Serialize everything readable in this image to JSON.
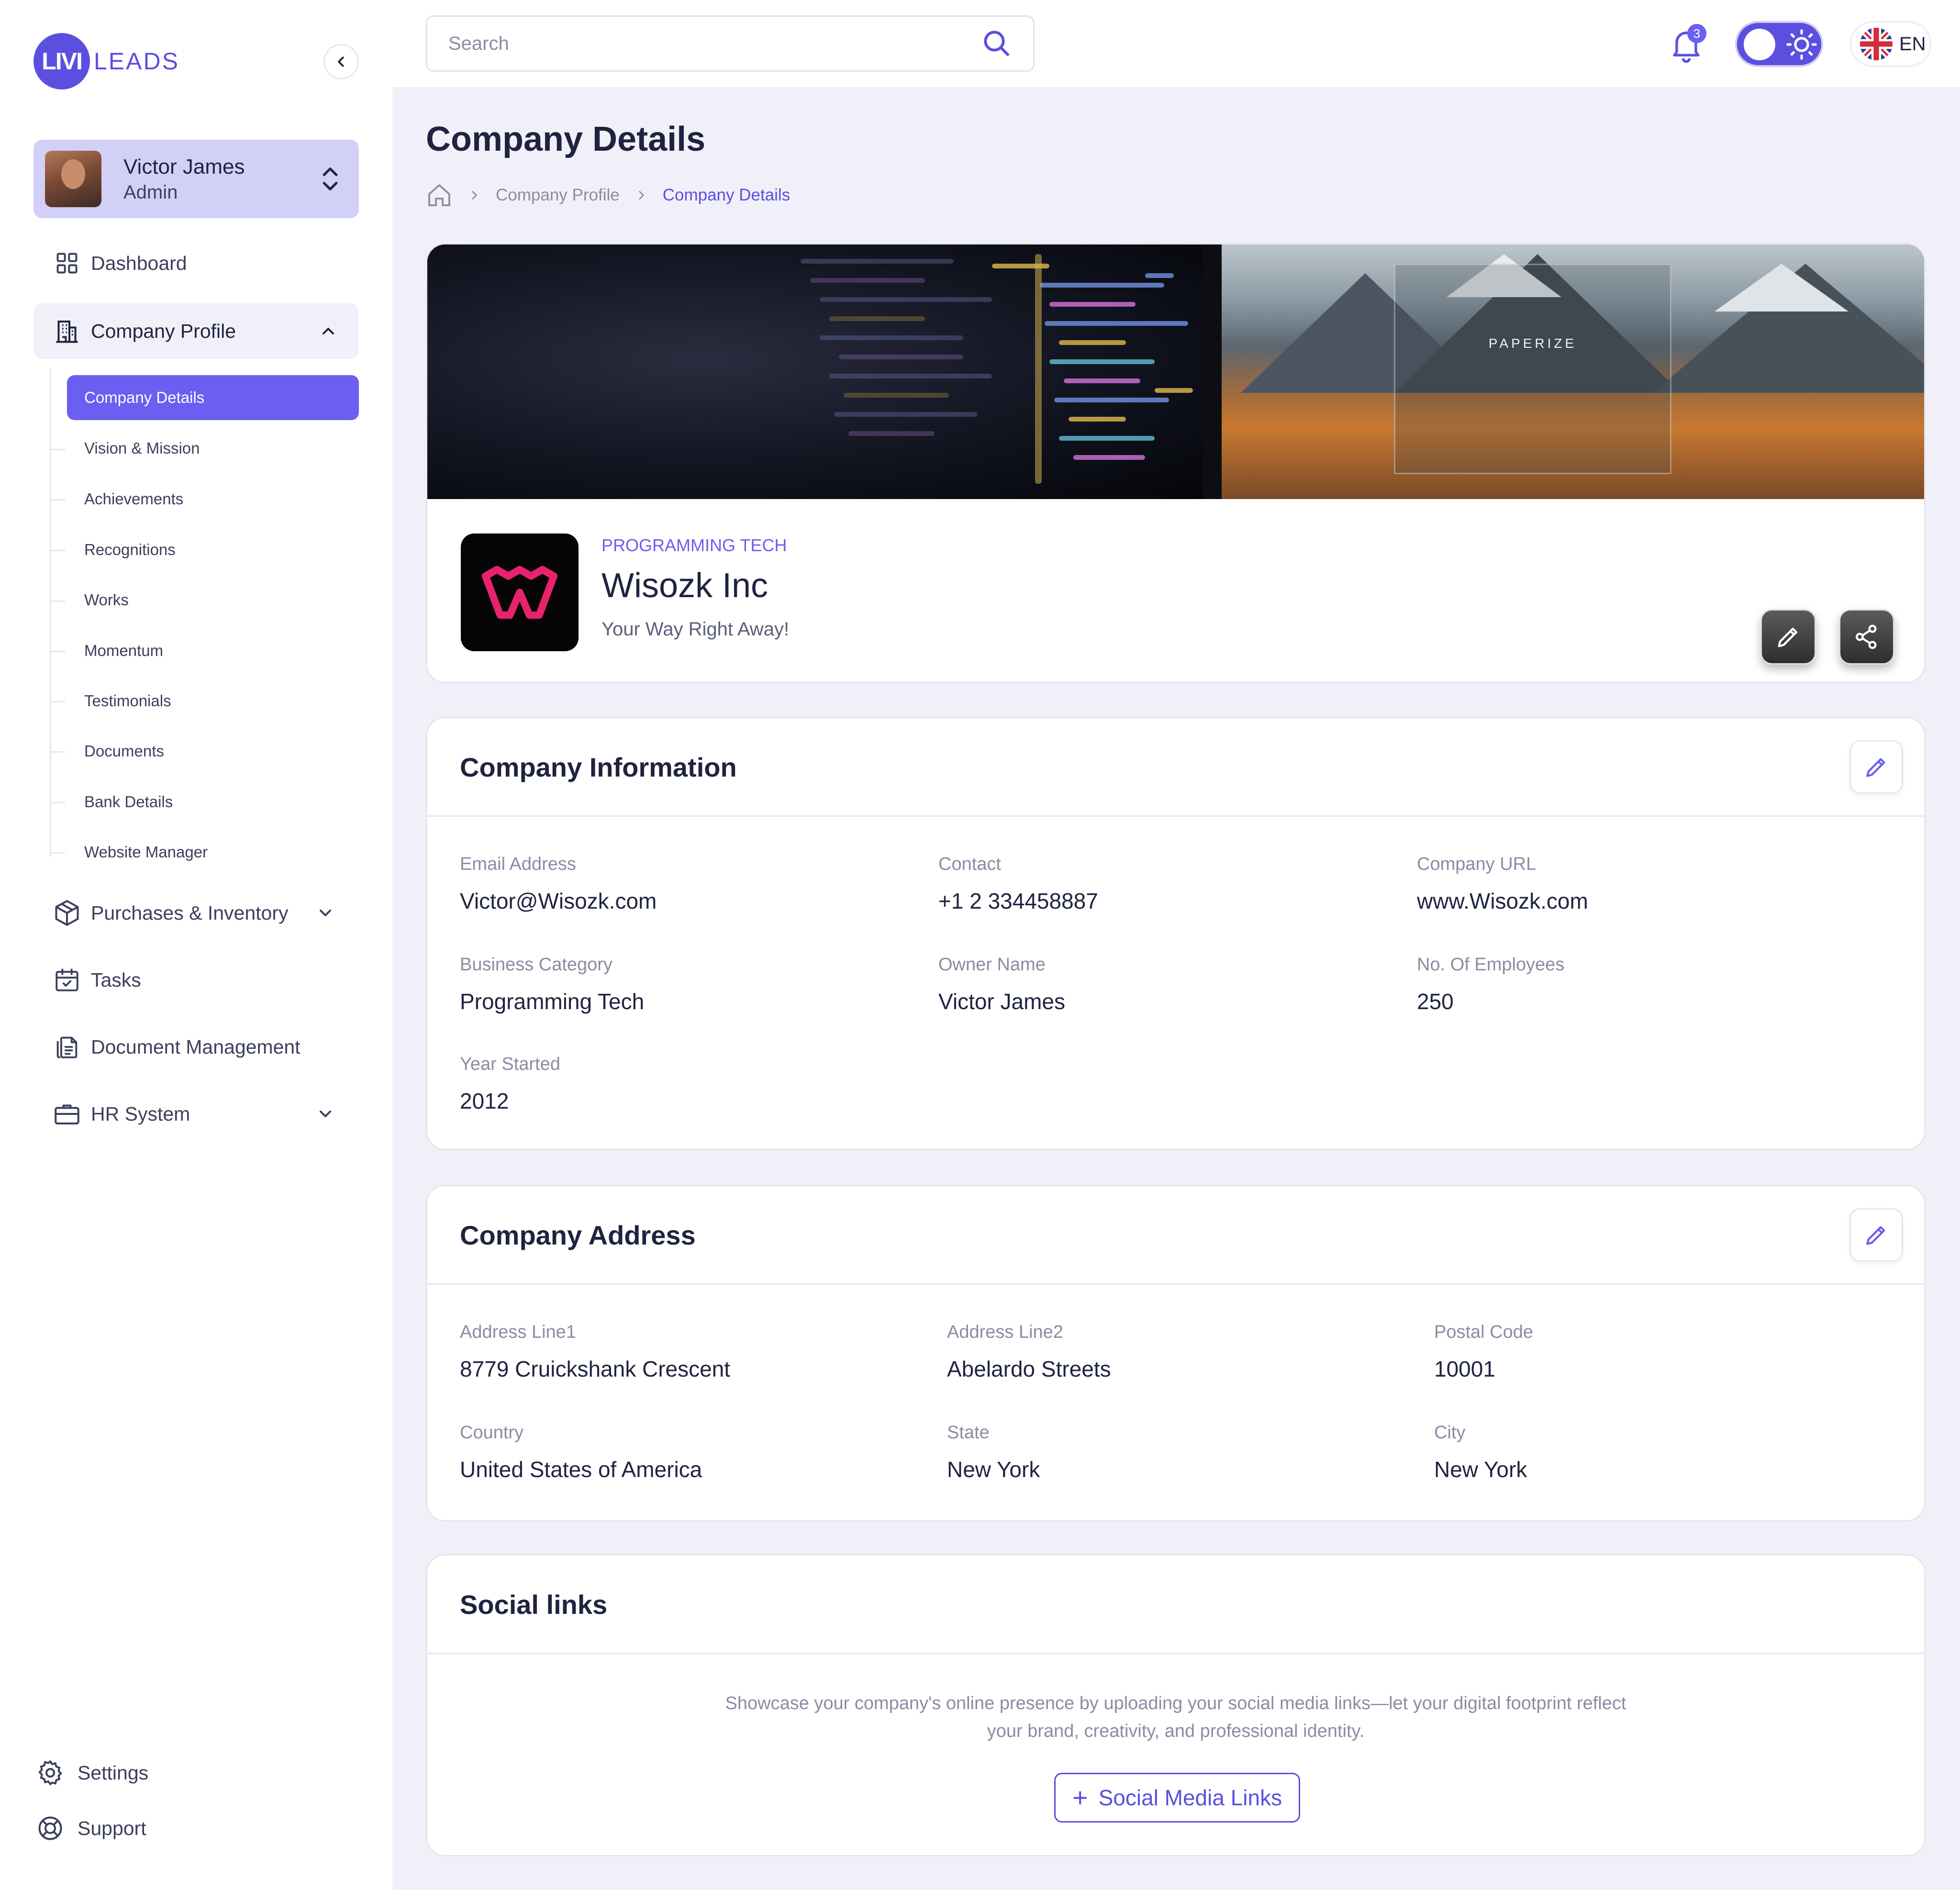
{
  "brand": {
    "logo_mark": "LIVI",
    "logo_text": "LEADS",
    "color": "#5b4fe0"
  },
  "user": {
    "name": "Victor James",
    "role": "Admin"
  },
  "nav": {
    "dashboard": "Dashboard",
    "company_profile": "Company Profile",
    "sub_items": [
      "Company Details",
      "Vision & Mission",
      "Achievements",
      "Recognitions",
      "Works",
      "Momentum",
      "Testimonials",
      "Documents",
      "Bank Details",
      "Website Manager"
    ],
    "purchases": "Purchases & Inventory",
    "tasks": "Tasks",
    "documents": "Document Management",
    "hr": "HR System",
    "settings": "Settings",
    "support": "Support"
  },
  "topbar": {
    "search_placeholder": "Search",
    "notification_count": "3",
    "language": "EN"
  },
  "page": {
    "title": "Company Details",
    "breadcrumb": [
      "Company Profile",
      "Company Details"
    ]
  },
  "hero": {
    "brand_text": "PAPERIZE"
  },
  "company": {
    "category": "PROGRAMMING TECH",
    "name": "Wisozk Inc",
    "tagline": "Your Way Right Away!"
  },
  "info": {
    "title": "Company Information",
    "fields": [
      {
        "label": "Email Address",
        "value": "Victor@Wisozk.com"
      },
      {
        "label": "Contact",
        "value": "+1 2 334458887"
      },
      {
        "label": "Company URL",
        "value": "www.Wisozk.com"
      },
      {
        "label": "Business Category",
        "value": "Programming Tech"
      },
      {
        "label": "Owner Name",
        "value": "Victor James"
      },
      {
        "label": "No. Of Employees",
        "value": "250"
      },
      {
        "label": "Year Started",
        "value": "2012"
      }
    ]
  },
  "address": {
    "title": "Company Address",
    "fields": [
      {
        "label": "Address Line1",
        "value": "8779 Cruickshank Crescent"
      },
      {
        "label": "Address Line2",
        "value": "Abelardo Streets"
      },
      {
        "label": "Postal Code",
        "value": "10001"
      },
      {
        "label": "Country",
        "value": "United States of America"
      },
      {
        "label": "State",
        "value": "New York"
      },
      {
        "label": "City",
        "value": "New York"
      }
    ]
  },
  "social": {
    "title": "Social links",
    "description_line1": "Showcase your company's online presence by uploading your social media links—let your digital footprint reflect",
    "description_line2": "your brand, creativity, and professional identity.",
    "button_label": "Social Media Links"
  },
  "colors": {
    "accent": "#6a5ff0",
    "text": "#1f2340",
    "muted": "#8a8ca3",
    "background": "#f1f0f8"
  }
}
